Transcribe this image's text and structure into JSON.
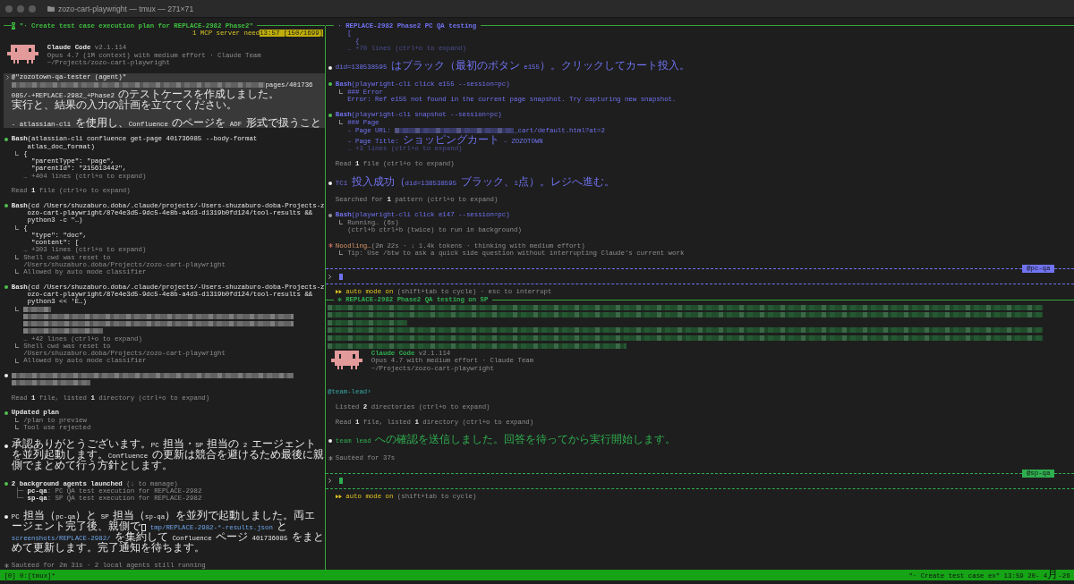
{
  "window": {
    "title": "zozo-cart-playwright — tmux — 271×71"
  },
  "main_pane": {
    "index": "0",
    "title": "\"· Create test case execution plan for REPLACE-2982 Phase2\"",
    "notice": "1 MCP server need",
    "scroll_position": "13:57 [150/1699]",
    "blocks": [
      {
        "kind": "header",
        "name": "Claude Code",
        "version": "v2.1.114",
        "details": [
          "Opus 4.7 (1M context) with medium effort · Claude Team",
          "~/Projects/zozo-cart-playwright"
        ]
      },
      {
        "kind": "user_prompt",
        "paragraphs": [
          {
            "rows": [
              "@\"zozotown-qa-tester (agent)\"",
              [
                {
                  "kind": "redacted"
                },
                {
                  "kind": "text",
                  "text": "pages/401736"
                }
              ],
              "085/-+REPLACE-2982_+Phase2 のテストケースを作成しました。",
              "実行と、結果の入力の計画を立ててください。"
            ]
          },
          {
            "rows": [
              "- atlassian-cli を使用し、Confluence のページを ADF 形式で扱うこと"
            ]
          }
        ]
      },
      {
        "kind": "tool",
        "running": false,
        "command": [
          "**Bash**(atlassian-cli confluence get-page 401736085 --body-format",
          "atlas_doc_format)"
        ],
        "results": [
          [
            {
              "kind": "output",
              "rows": [
                "{"
              ]
            },
            {
              "kind": "nested",
              "rows": [
                "\"parentType\": \"page\","
              ]
            },
            {
              "kind": "nested",
              "rows": [
                "\"parentId\": \"215613442\","
              ]
            },
            {
              "kind": "more",
              "rows": [
                "… +404 lines (ctrl+o to expand)"
              ]
            }
          ]
        ]
      },
      {
        "kind": "summary",
        "text": "Read **1** file (ctrl+o to expand)"
      },
      {
        "kind": "tool",
        "running": false,
        "command": [
          "**Bash**(cd /Users/shuzaburo.doba/.claude/projects/-Users-shuzaburo-doba-Projects-z",
          "ozo-cart-playwright/87e4e3d5-9dc5-4e8b-a4d3-d1319b0fd124/tool-results &&",
          "python3 -c \"…)"
        ],
        "results": [
          [
            {
              "kind": "output",
              "rows": [
                "{"
              ]
            },
            {
              "kind": "nested",
              "rows": [
                "\"type\": \"doc\","
              ]
            },
            {
              "kind": "nested",
              "rows": [
                "\"content\": ["
              ]
            },
            {
              "kind": "more",
              "rows": [
                "… +303 lines (ctrl+o to expand)"
              ]
            }
          ],
          [
            {
              "kind": "note",
              "rows": [
                "Shell cwd was reset to",
                "/Users/shuzaburo.doba/Projects/zozo-cart-playwright"
              ]
            }
          ],
          [
            {
              "kind": "note",
              "rows": [
                "Allowed by auto mode classifier"
              ]
            }
          ]
        ]
      },
      {
        "kind": "tool",
        "running": false,
        "command": [
          "**Bash**(cd /Users/shuzaburo.doba/.claude/projects/-Users-shuzaburo-doba-Projects-z",
          "ozo-cart-playwright/87e4e3d5-9dc5-4e8b-a4d3-d1319b0fd124/tool-results &&",
          "python3 << 'E…)"
        ],
        "results": [
          [
            {
              "kind": "redacted_short"
            },
            {
              "kind": "redacted"
            },
            {
              "kind": "redacted"
            },
            {
              "kind": "redacted_medium"
            },
            {
              "kind": "more",
              "rows": [
                "… +42 lines (ctrl+o to expand)"
              ]
            }
          ],
          [
            {
              "kind": "note",
              "rows": [
                "Shell cwd was reset to",
                "/Users/shuzaburo.doba/Projects/zozo-cart-playwright"
              ]
            }
          ],
          [
            {
              "kind": "note",
              "rows": [
                "Allowed by auto mode classifier"
              ]
            }
          ]
        ]
      },
      {
        "kind": "message",
        "items": [
          {
            "kind": "redacted"
          },
          {
            "kind": "redacted_medium"
          }
        ]
      },
      {
        "kind": "summary",
        "text": "Read **1** file, listed **1** directory (ctrl+o to expand)"
      },
      {
        "kind": "plan",
        "title": "Updated plan",
        "results": [
          [
            {
              "kind": "note",
              "rows": [
                "/plan to preview"
              ]
            }
          ],
          [
            {
              "kind": "note",
              "rows": [
                "Tool use rejected"
              ]
            }
          ]
        ]
      },
      {
        "kind": "message",
        "items": [
          {
            "kind": "text",
            "text": "承認ありがとうございます。PC 担当・SP 担当の 2 エージェントを並列起動します。Confluence の更新は競合を避けるため最後に親側でまとめて行う方針とします。"
          }
        ]
      },
      {
        "kind": "agents",
        "title": "**2 background agents launched** (↓ to manage)",
        "agents": [
          "├─ **pc-qa**: PC QA test execution for REPLACE-2982",
          "└─ **sp-qa**: SP QA test execution for REPLACE-2982"
        ]
      },
      {
        "kind": "message",
        "items": [
          {
            "kind": "text",
            "segments": [
              {
                "kind": "text",
                "text": "PC 担当（pc-qa）と SP 担当（sp-qa）を並列で起動しました。両エージェント完了後、親側で"
              },
              {
                "kind": "cursor"
              },
              {
                "kind": "path",
                "text": "tmp/REPLACE-2982-*-results.json"
              },
              {
                "kind": "text",
                "text": " と "
              },
              {
                "kind": "path",
                "text": "screenshots/REPLACE-2982/"
              },
              {
                "kind": "text",
                "text": " を集約して Confluence ページ 401736085 をまとめて更新します。完了通知を待ちます。"
              }
            ]
          }
        ]
      },
      {
        "kind": "spinner",
        "active": false,
        "text": "Sautéed for 2m 31s · 2 local agents still running"
      }
    ]
  },
  "agent_panes": [
    {
      "title": "· REPLACE-2982 Phase2 PC QA testing",
      "color": "#7073f2",
      "blocks": [
        {
          "kind": "continuation",
          "items": [
            {
              "kind": "output",
              "rows": [
                "["
              ]
            },
            {
              "kind": "nested",
              "rows": [
                "{"
              ]
            },
            {
              "kind": "more",
              "rows": [
                "… +70 lines (ctrl+o to expand)"
              ]
            }
          ]
        },
        {
          "kind": "message",
          "items": [
            {
              "kind": "text",
              "text": "did=138538595 はブラック（最初のボタン e155）。クリックしてカート投入。"
            }
          ]
        },
        {
          "kind": "tool",
          "running": false,
          "command": [
            "**Bash**(playwright-cli click e155 --session=pc)"
          ],
          "results": [
            [
              {
                "kind": "output",
                "rows": [
                  "### Error"
                ]
              },
              {
                "kind": "output",
                "rows": [
                  "Error: Ref e155 not found in the current page snapshot. Try capturing new snapshot."
                ]
              }
            ]
          ]
        },
        {
          "kind": "tool",
          "running": false,
          "command": [
            "**Bash**(playwright-cli snapshot --session=pc)"
          ],
          "results": [
            [
              {
                "kind": "output",
                "rows": [
                  "### Page"
                ]
              },
              {
                "kind": "output",
                "rows": [
                  [
                    {
                      "kind": "text",
                      "text": "- Page URL: "
                    },
                    {
                      "kind": "redacted"
                    },
                    {
                      "kind": "text",
                      "text": "_cart/default.html?at=2"
                    }
                  ]
                ]
              },
              {
                "kind": "output",
                "rows": [
                  "- Page Title: ショッピングカート - ZOZOTOWN"
                ]
              },
              {
                "kind": "more",
                "rows": [
                  "… +3 lines (ctrl+o to expand)"
                ]
              }
            ]
          ]
        },
        {
          "kind": "summary",
          "text": "Read **1** file (ctrl+o to expand)"
        },
        {
          "kind": "message",
          "items": [
            {
              "kind": "text",
              "text": "TC1 投入成功（did=138538595 ブラック、1点）。レジへ進む。"
            }
          ]
        },
        {
          "kind": "summary",
          "text": "Searched for **1** pattern (ctrl+o to expand)"
        },
        {
          "kind": "tool",
          "running": true,
          "command": [
            "**Bash**(playwright-cli click e147 --session=pc)"
          ],
          "results": [
            [
              {
                "kind": "note",
                "rows": [
                  "Running… (6s)"
                ]
              },
              {
                "kind": "note",
                "rows": [
                  "(ctrl+b ctrl+b (twice) to run in background)"
                ]
              }
            ]
          ]
        },
        {
          "kind": "spinner",
          "active": true,
          "text": "Noodling…",
          "detail": "(2m 22s · ↓ 1.4k tokens · thinking with medium effort)",
          "results": [
            [
              {
                "kind": "note",
                "rows": [
                  "Tip: Use /btw to ask a quick side question without interrupting Claude's current work"
                ]
              }
            ]
          ]
        }
      ],
      "input": {
        "badge": "@pc-qa",
        "mode": "auto mode on",
        "hint": "(shift+tab to cycle) · esc to interrupt"
      }
    },
    {
      "title": "✻ REPLACE-2982 Phase2 QA testing on SP",
      "color": "#2fae4f",
      "blocks": [
        {
          "kind": "banner",
          "items": [
            {
              "kind": "redacted"
            },
            {
              "kind": "redacted"
            },
            {
              "kind": "redacted_medium"
            },
            {
              "kind": "redacted"
            },
            {
              "kind": "redacted"
            },
            {
              "kind": "redacted_half"
            }
          ]
        },
        {
          "kind": "header",
          "name": "Claude Code",
          "version": "v2.1.114",
          "details": [
            "Opus 4.7 with medium effort · Claude Team",
            "~/Projects/zozo-cart-playwright"
          ]
        },
        {
          "kind": "mention",
          "text": "@team-lead›"
        },
        {
          "kind": "summary",
          "text": "Listed **2** directories (ctrl+o to expand)"
        },
        {
          "kind": "summary",
          "text": "Read **1** file, listed **1** directory (ctrl+o to expand)"
        },
        {
          "kind": "message",
          "items": [
            {
              "kind": "text",
              "text": "team lead への確認を送信しました。回答を待ってから実行開始します。"
            }
          ]
        },
        {
          "kind": "spinner",
          "active": false,
          "text": "Sautéed for 37s"
        }
      ],
      "input": {
        "badge": "@sp-qa",
        "mode": "auto mode on",
        "hint": "(shift+tab to cycle)"
      }
    }
  ],
  "status_bar": {
    "session": "[0] 0:[tmux]*",
    "right": "\"· Create test case ex\" 13:59 20- 4月-26"
  }
}
